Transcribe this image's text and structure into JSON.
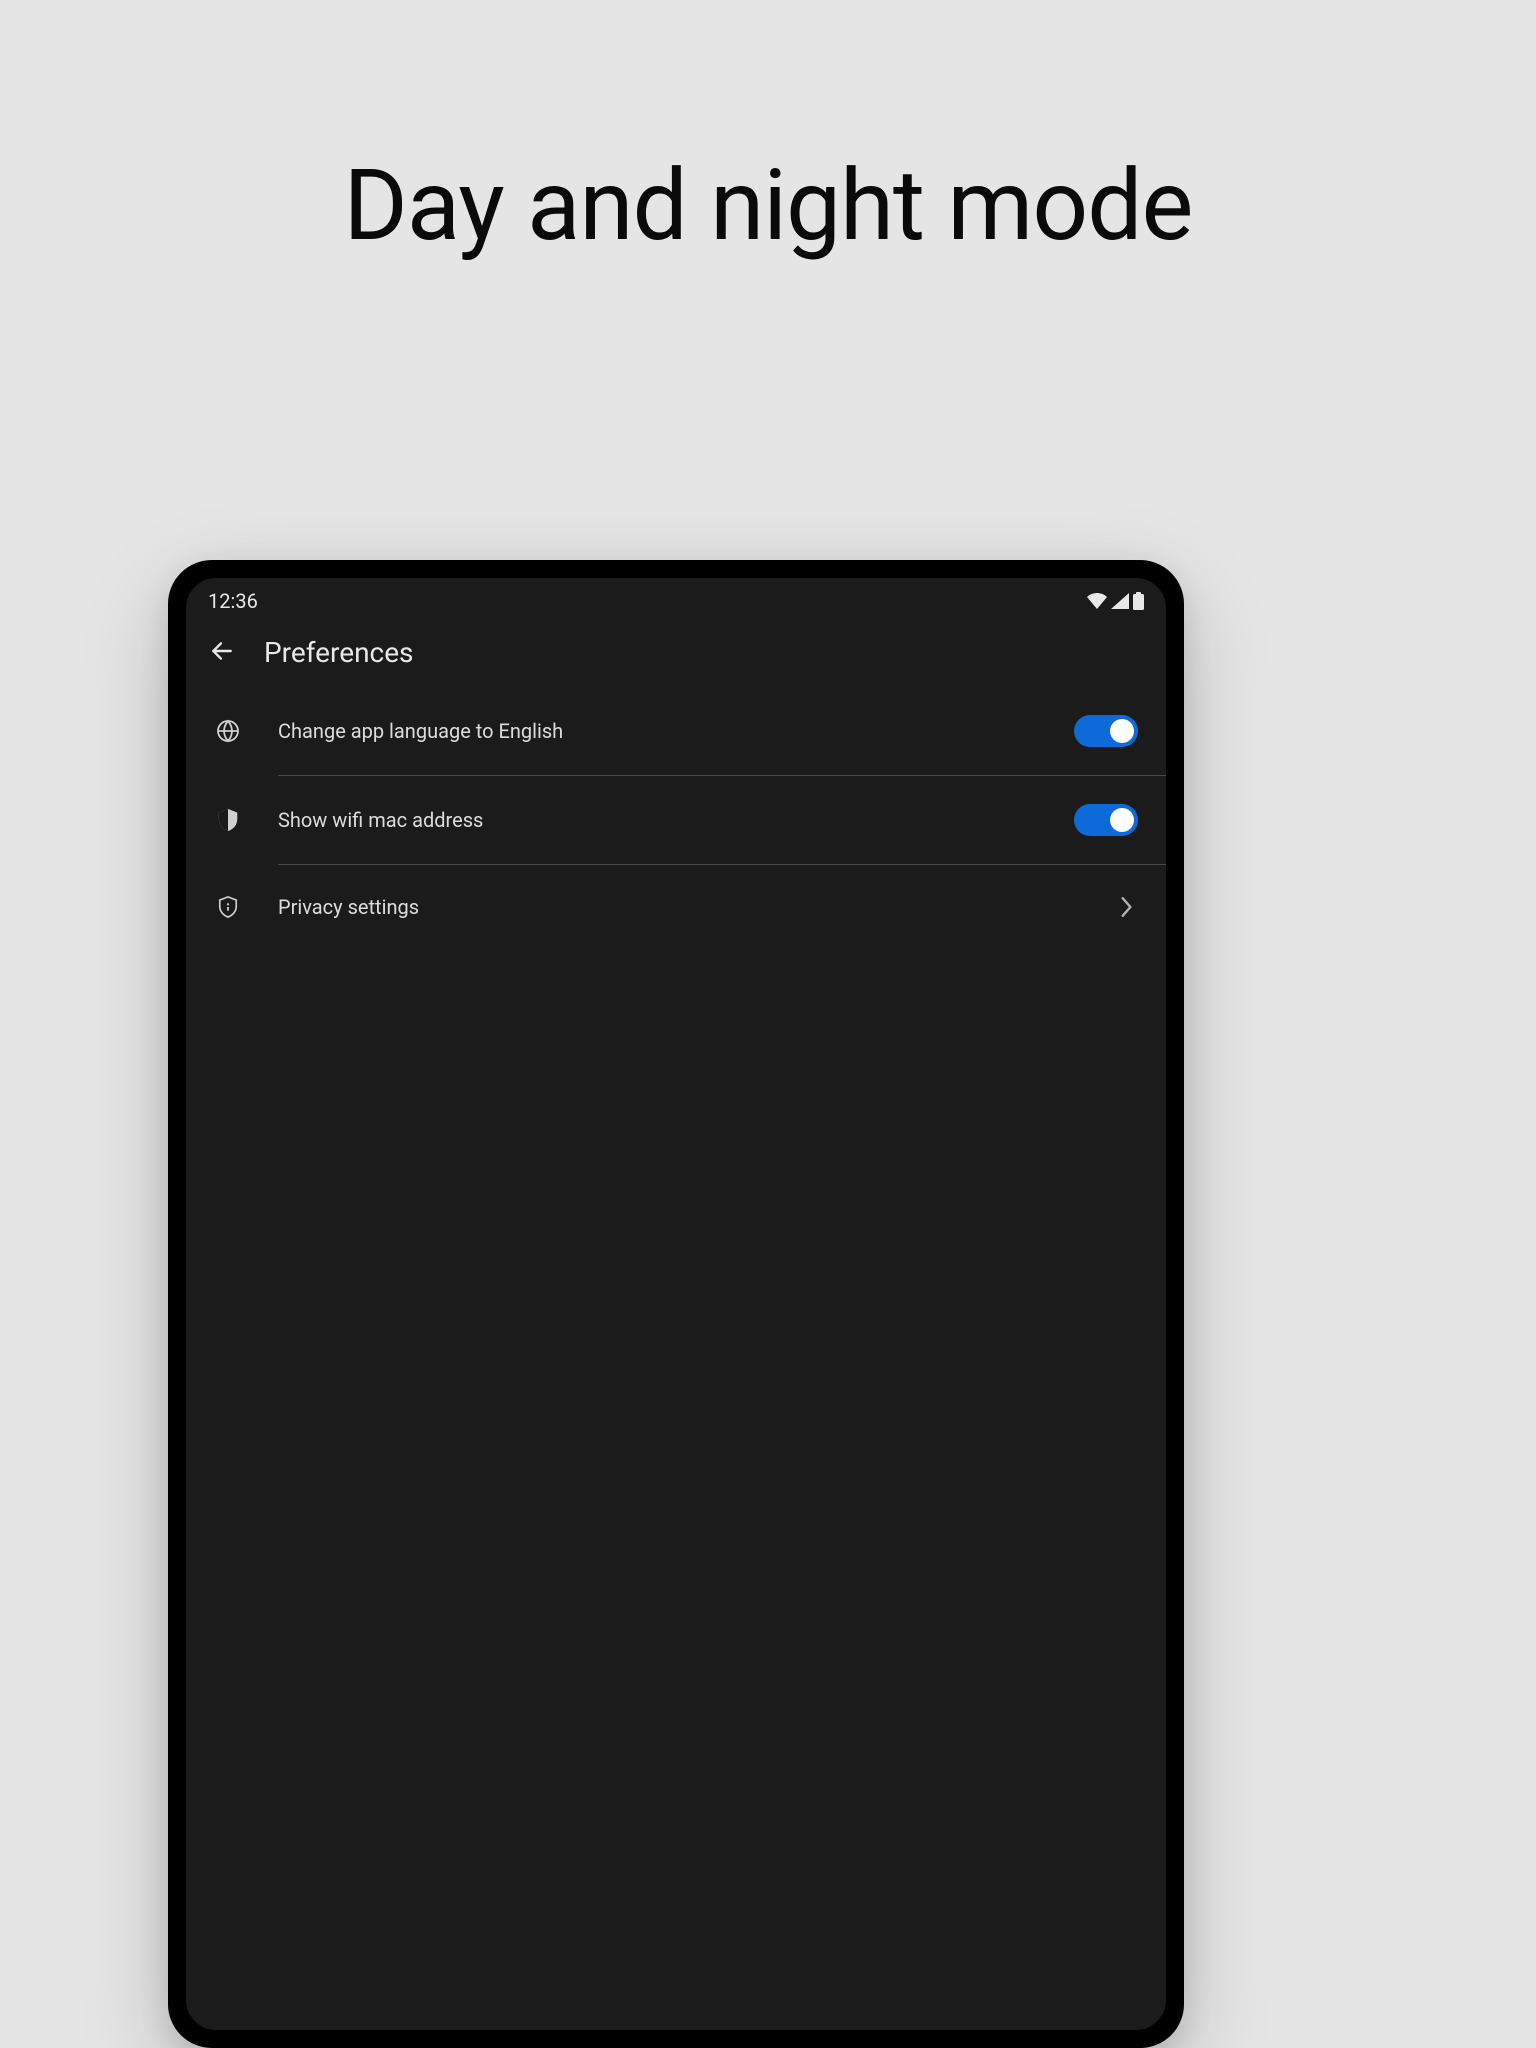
{
  "page": {
    "title": "Day and night mode"
  },
  "status": {
    "time": "12:36"
  },
  "appbar": {
    "title": "Preferences"
  },
  "settings": {
    "items": [
      {
        "label": "Change app language to English",
        "icon": "globe-icon",
        "toggle_on": true
      },
      {
        "label": "Show wifi mac address",
        "icon": "shield-icon",
        "toggle_on": true
      },
      {
        "label": "Privacy settings",
        "icon": "privacy-shield-icon",
        "has_chevron": true
      }
    ]
  },
  "colors": {
    "background": "#e5e5e5",
    "device_bg": "#1b1b1b",
    "accent": "#0c6bd8",
    "text": "#dcdcdc"
  }
}
